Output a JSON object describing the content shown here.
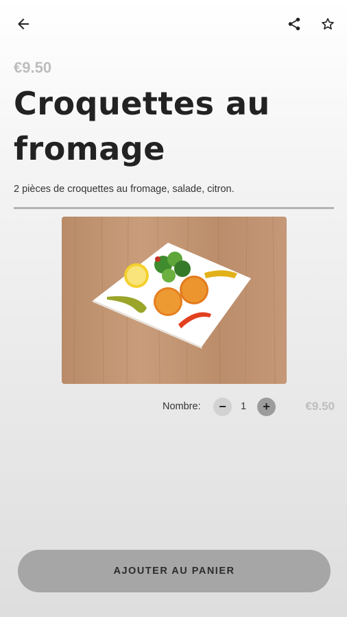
{
  "header": {
    "back_icon": "arrow-left-icon",
    "share_icon": "share-icon",
    "favorite_icon": "star-outline-icon"
  },
  "product": {
    "price": "€9.50",
    "title": "Croquettes au fromage",
    "description": "2 pièces de croquettes au fromage, salade, citron."
  },
  "quantity": {
    "label": "Nombre:",
    "value": "1",
    "line_total": "€9.50"
  },
  "cart": {
    "button_label": "AJOUTER AU PANIER"
  },
  "colors": {
    "muted_price": "#bdbdbd",
    "button_bg": "#a6a6a6",
    "divider": "#b3b3b3"
  }
}
